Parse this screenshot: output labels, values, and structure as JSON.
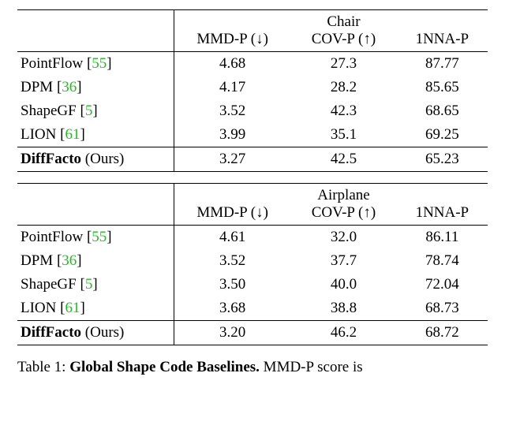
{
  "caption": {
    "label": "Table 1:",
    "title": "Global Shape Code Baselines.",
    "trail": " MMD-P score is"
  },
  "arrows": {
    "down": " (↓)",
    "up": " (↑)"
  },
  "cols": {
    "mmd": "MMD-P",
    "cov": "COV-P",
    "nna": "1NNA-P"
  },
  "chart_data": [
    {
      "type": "table",
      "title": "Chair",
      "cols": [
        "MMD-P (↓)",
        "COV-P (↑)",
        "1NNA-P"
      ],
      "rows": [
        {
          "name": "PointFlow",
          "cite": "55",
          "mmd": "4.68",
          "cov": "27.3",
          "nna": "87.77",
          "bold": false
        },
        {
          "name": "DPM",
          "cite": "36",
          "mmd": "4.17",
          "cov": "28.2",
          "nna": "85.65",
          "bold": false
        },
        {
          "name": "ShapeGF",
          "cite": "5",
          "mmd": "3.52",
          "cov": "42.3",
          "nna": "68.65",
          "bold": false
        },
        {
          "name": "LION",
          "cite": "61",
          "mmd": "3.99",
          "cov": "35.1",
          "nna": "69.25",
          "bold": false
        }
      ],
      "ours": {
        "name": "DiffFacto",
        "suffix": " (Ours)",
        "mmd": "3.27",
        "cov": "42.5",
        "nna": "65.23"
      }
    },
    {
      "type": "table",
      "title": "Airplane",
      "cols": [
        "MMD-P (↓)",
        "COV-P (↑)",
        "1NNA-P"
      ],
      "rows": [
        {
          "name": "PointFlow",
          "cite": "55",
          "mmd": "4.61",
          "cov": "32.0",
          "nna": "86.11",
          "bold": false
        },
        {
          "name": "DPM",
          "cite": "36",
          "mmd": "3.52",
          "cov": "37.7",
          "nna": "78.74",
          "bold": false
        },
        {
          "name": "ShapeGF",
          "cite": "5",
          "mmd": "3.50",
          "cov": "40.0",
          "nna": "72.04",
          "bold": false
        },
        {
          "name": "LION",
          "cite": "61",
          "mmd": "3.68",
          "cov": "38.8",
          "nna": "68.73",
          "bold": false
        }
      ],
      "ours": {
        "name": "DiffFacto",
        "suffix": " (Ours)",
        "mmd": "3.20",
        "cov": "46.2",
        "nna": "68.72"
      }
    }
  ]
}
